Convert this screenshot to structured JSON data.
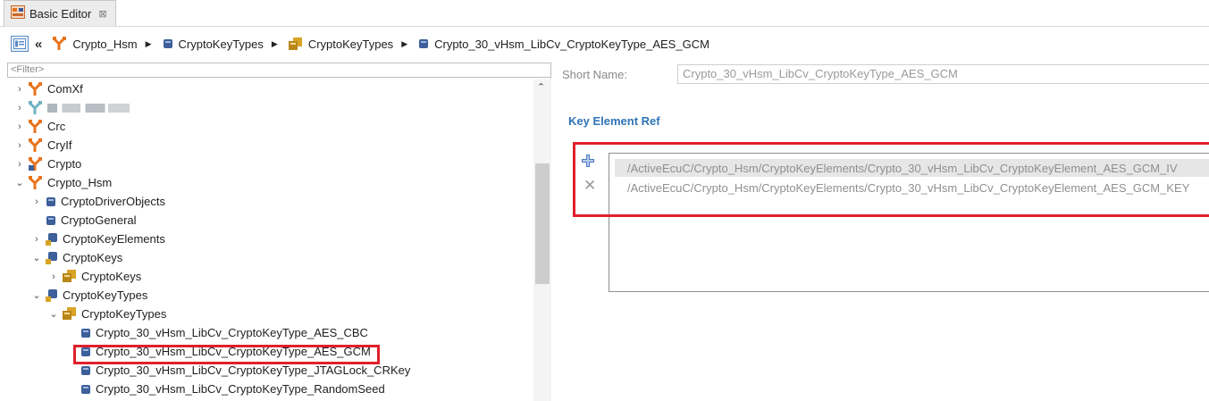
{
  "tab": {
    "label": "Basic Editor",
    "close_glyph": "⊠"
  },
  "breadcrumb": {
    "back_glyph": "«",
    "separator_glyph": "▶",
    "items": [
      {
        "label": "Crypto_Hsm",
        "icon": "module-fork-icon"
      },
      {
        "label": "CryptoKeyTypes",
        "icon": "container-icon"
      },
      {
        "label": "CryptoKeyTypes",
        "icon": "container-stack-icon"
      },
      {
        "label": "Crypto_30_vHsm_LibCv_CryptoKeyType_AES_GCM",
        "icon": "container-icon"
      }
    ]
  },
  "filter": {
    "placeholder": "<Filter>"
  },
  "tree": {
    "items": [
      {
        "label": "ComXf",
        "arrow": "›"
      },
      {
        "label": "",
        "arrow": "›",
        "blurred": true
      },
      {
        "label": "Crc",
        "arrow": "›"
      },
      {
        "label": "CryIf",
        "arrow": "›"
      },
      {
        "label": "Crypto",
        "arrow": "›"
      },
      {
        "label": "Crypto_Hsm",
        "arrow": "⌄"
      },
      {
        "label": "CryptoDriverObjects",
        "arrow": "›"
      },
      {
        "label": "CryptoGeneral",
        "arrow": ""
      },
      {
        "label": "CryptoKeyElements",
        "arrow": "›"
      },
      {
        "label": "CryptoKeys",
        "arrow": "⌄"
      },
      {
        "label": "CryptoKeys",
        "arrow": "›"
      },
      {
        "label": "CryptoKeyTypes",
        "arrow": "⌄"
      },
      {
        "label": "CryptoKeyTypes",
        "arrow": "⌄"
      },
      {
        "label": "Crypto_30_vHsm_LibCv_CryptoKeyType_AES_CBC",
        "arrow": ""
      },
      {
        "label": "Crypto_30_vHsm_LibCv_CryptoKeyType_AES_GCM",
        "arrow": ""
      },
      {
        "label": "Crypto_30_vHsm_LibCv_CryptoKeyType_JTAGLock_CRKey",
        "arrow": ""
      },
      {
        "label": "Crypto_30_vHsm_LibCv_CryptoKeyType_RandomSeed",
        "arrow": ""
      }
    ],
    "selected_label": "Crypto_30_vHsm_LibCv_CryptoKeyType_AES_GCM"
  },
  "scrollbar": {
    "up_glyph": "⌃"
  },
  "details": {
    "short_name_label": "Short Name:",
    "short_name_value": "Crypto_30_vHsm_LibCv_CryptoKeyType_AES_GCM",
    "section_title": "Key Element Ref",
    "refs": [
      "/ActiveEcuC/Crypto_Hsm/CryptoKeyElements/Crypto_30_vHsm_LibCv_CryptoKeyElement_AES_GCM_IV",
      "/ActiveEcuC/Crypto_Hsm/CryptoKeyElements/Crypto_30_vHsm_LibCv_CryptoKeyElement_AES_GCM_KEY"
    ],
    "remove_glyph": "✕"
  },
  "colors": {
    "highlight_red": "#e0202c",
    "section_blue": "#2e74b5",
    "module_orange": "#e8731c",
    "container_blue": "#3d5f9a",
    "stack_gold": "#d9a426"
  }
}
